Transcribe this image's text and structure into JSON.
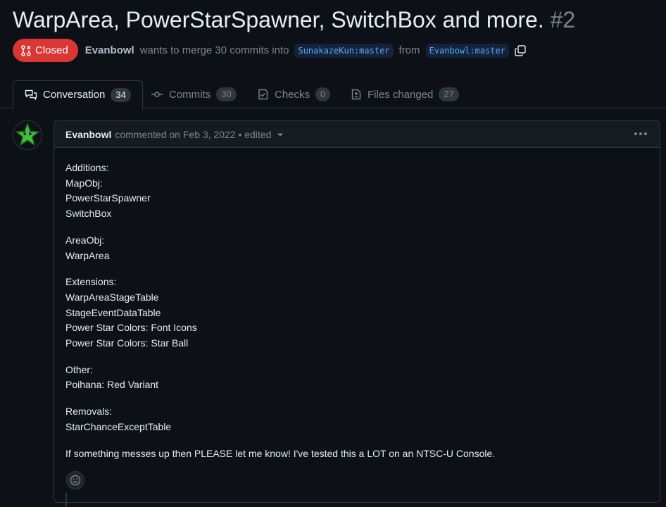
{
  "pr": {
    "title": "WarpArea, PowerStarSpawner, SwitchBox and more.",
    "number": "#2",
    "state_label": "Closed",
    "author": "Evanbowl",
    "merge_text": "wants to merge 30 commits into",
    "base_branch": "SunakazeKun:master",
    "from_text": "from",
    "head_branch": "Evanbowl:master"
  },
  "tabs": [
    {
      "label": "Conversation",
      "count": "34",
      "icon": "comment-discussion-icon"
    },
    {
      "label": "Commits",
      "count": "30",
      "icon": "git-commit-icon"
    },
    {
      "label": "Checks",
      "count": "0",
      "icon": "checklist-icon"
    },
    {
      "label": "Files changed",
      "count": "27",
      "icon": "file-diff-icon"
    }
  ],
  "comment": {
    "author": "Evanbowl",
    "meta": "commented on Feb 3, 2022 • edited",
    "body": [
      [
        "Additions:",
        "MapObj:",
        "PowerStarSpawner",
        "SwitchBox"
      ],
      [
        "AreaObj:",
        "WarpArea"
      ],
      [
        "Extensions:",
        "WarpAreaStageTable",
        "StageEventDataTable",
        "Power Star Colors: Font Icons",
        "Power Star Colors: Star Ball"
      ],
      [
        "Other:",
        "Poihana: Red Variant"
      ],
      [
        "Removals:",
        "StarChanceExceptTable"
      ],
      [
        "If something messes up then PLEASE let me know! I've tested this a LOT on an NTSC-U Console."
      ]
    ]
  },
  "colors": {
    "background": "#0d1117",
    "closed_badge": "#da3633",
    "link": "#58a6ff",
    "border": "#30363d"
  }
}
